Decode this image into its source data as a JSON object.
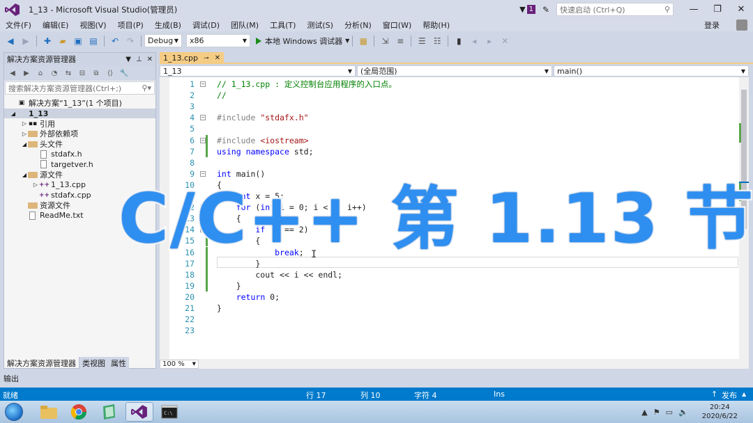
{
  "window": {
    "title": "1_13 - Microsoft Visual Studio(管理员)",
    "notification_count": "1",
    "quick_launch_placeholder": "快速启动 (Ctrl+Q)",
    "login": "登录"
  },
  "menu": [
    "文件(F)",
    "编辑(E)",
    "视图(V)",
    "项目(P)",
    "生成(B)",
    "调试(D)",
    "团队(M)",
    "工具(T)",
    "测试(S)",
    "分析(N)",
    "窗口(W)",
    "帮助(H)"
  ],
  "toolbar": {
    "config": "Debug",
    "platform": "x86",
    "run_label": "本地 Windows 调试器"
  },
  "solution_explorer": {
    "title": "解决方案资源管理器",
    "search_placeholder": "搜索解决方案资源管理器(Ctrl+;)",
    "items": [
      {
        "label": "解决方案“1_13”(1 个项目)",
        "depth": 0,
        "kind": "solution",
        "twisty": ""
      },
      {
        "label": "1_13",
        "depth": 0,
        "kind": "project",
        "twisty": "◢"
      },
      {
        "label": "引用",
        "depth": 1,
        "kind": "ref",
        "twisty": "▷"
      },
      {
        "label": "外部依赖项",
        "depth": 1,
        "kind": "folder",
        "twisty": "▷"
      },
      {
        "label": "头文件",
        "depth": 1,
        "kind": "folder",
        "twisty": "◢"
      },
      {
        "label": "stdafx.h",
        "depth": 2,
        "kind": "file",
        "twisty": ""
      },
      {
        "label": "targetver.h",
        "depth": 2,
        "kind": "file",
        "twisty": ""
      },
      {
        "label": "源文件",
        "depth": 1,
        "kind": "folder",
        "twisty": "◢"
      },
      {
        "label": "1_13.cpp",
        "depth": 2,
        "kind": "cpp",
        "twisty": "▷"
      },
      {
        "label": "stdafx.cpp",
        "depth": 2,
        "kind": "cpp",
        "twisty": ""
      },
      {
        "label": "资源文件",
        "depth": 1,
        "kind": "folder",
        "twisty": ""
      },
      {
        "label": "ReadMe.txt",
        "depth": 1,
        "kind": "file",
        "twisty": ""
      }
    ],
    "tabs": [
      "解决方案资源管理器",
      "类视图",
      "属性"
    ]
  },
  "editor": {
    "tab": "1_13.cpp",
    "nav_project": "1_13",
    "nav_scope": "(全局范围)",
    "nav_member": "main()",
    "zoom": "100 %",
    "lines": [
      {
        "n": "1",
        "text": "// 1_13.cpp : 定义控制台应用程序的入口点。",
        "cls": "c-com"
      },
      {
        "n": "2",
        "text": "//",
        "cls": "c-com"
      },
      {
        "n": "3",
        "text": "",
        "cls": "c-id"
      },
      {
        "n": "4",
        "text": "#include \"stdafx.h\"",
        "cls": "c-pp"
      },
      {
        "n": "5",
        "text": "",
        "cls": "c-id"
      },
      {
        "n": "6",
        "text": "#include <iostream>",
        "cls": "c-pp"
      },
      {
        "n": "7",
        "text": "using namespace std;",
        "cls": "c-id"
      },
      {
        "n": "8",
        "text": "",
        "cls": "c-id"
      },
      {
        "n": "9",
        "text": "int main()",
        "cls": "c-id"
      },
      {
        "n": "10",
        "text": "{",
        "cls": "c-id"
      },
      {
        "n": "11",
        "text": "    int x = 5;",
        "cls": "c-id"
      },
      {
        "n": "12",
        "text": "    for (int i = 0; i < x; i++)",
        "cls": "c-id"
      },
      {
        "n": "13",
        "text": "    {",
        "cls": "c-id"
      },
      {
        "n": "14",
        "text": "        if (i == 2)",
        "cls": "c-id"
      },
      {
        "n": "15",
        "text": "        {",
        "cls": "c-id"
      },
      {
        "n": "16",
        "text": "            break;",
        "cls": "c-id"
      },
      {
        "n": "17",
        "text": "        }",
        "cls": "c-id"
      },
      {
        "n": "18",
        "text": "        cout << i << endl;",
        "cls": "c-id"
      },
      {
        "n": "19",
        "text": "    }",
        "cls": "c-id"
      },
      {
        "n": "20",
        "text": "    return 0;",
        "cls": "c-id"
      },
      {
        "n": "21",
        "text": "}",
        "cls": "c-id"
      },
      {
        "n": "22",
        "text": "",
        "cls": "c-id"
      },
      {
        "n": "23",
        "text": "",
        "cls": "c-id"
      }
    ]
  },
  "output_label": "输出",
  "status": {
    "state": "就绪",
    "row": "行 17",
    "col": "列 10",
    "char": "字符 4",
    "mode": "Ins",
    "publish": "发布"
  },
  "taskbar": {
    "time": "20:24",
    "date": "2020/6/22"
  },
  "overlay_title": "C/C++ 第 1.13 节",
  "colors": {
    "accent": "#007acc",
    "doc_tab": "#f5cc84",
    "overlay": "#2f8ff0",
    "vs_purple": "#68217a"
  }
}
